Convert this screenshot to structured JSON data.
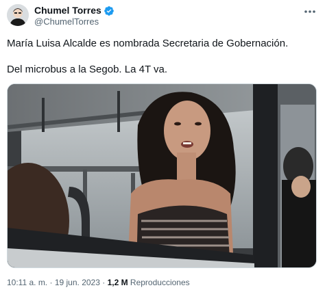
{
  "author": {
    "display_name": "Chumel Torres",
    "handle": "@ChumelTorres",
    "verified": true
  },
  "tweet": {
    "line1": "María Luisa Alcalde es nombrada Secretaria de Gobernación.",
    "line2": "Del microbus a la Segob. La 4T va."
  },
  "media": {
    "kind": "photo"
  },
  "meta": {
    "time": "10:11 a. m.",
    "separator1": " · ",
    "date": "19 jun. 2023",
    "separator2": " · ",
    "views_count": "1,2 M",
    "views_label": "Reproducciones"
  },
  "colors": {
    "verified_blue": "#1d9bf0",
    "secondary_text": "#536471",
    "primary_text": "#0f1419"
  }
}
